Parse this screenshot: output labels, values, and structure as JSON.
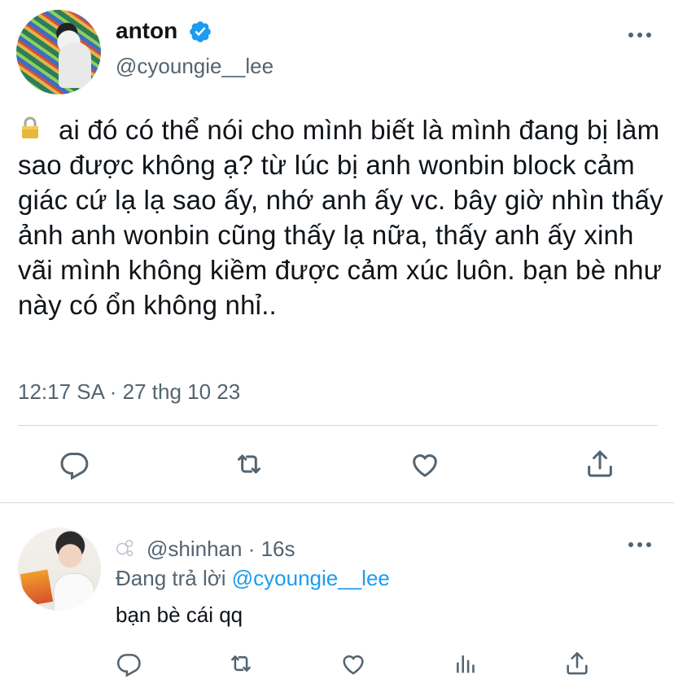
{
  "tweet": {
    "author_name": "anton",
    "author_handle": "@cyoungie__lee",
    "verified": true,
    "lock_emoji": "lock-icon",
    "text": "ai đó có thể nói cho mình biết là mình đang bị làm sao được không ạ? từ lúc bị anh wonbin block cảm giác cứ lạ lạ sao ấy, nhớ anh ấy vc. bây giờ nhìn thấy ảnh anh wonbin cũng thấy lạ nữa, thấy anh ấy xinh vãi mình không kiềm được cảm xúc luôn. bạn bè như này có ổn không nhỉ..",
    "timestamp": "12:17 SA · 27 thg 10 23"
  },
  "reply": {
    "handle": "@shinhan",
    "separator": " · ",
    "time": "16s",
    "replying_prefix": "Đang trả lời ",
    "replying_to": "@cyoungie__lee",
    "text": "bạn bè cái qq"
  },
  "colors": {
    "accent": "#1d9bf0",
    "muted": "#536471",
    "text": "#0f1419",
    "divider": "#cfd9de"
  },
  "icons": [
    "reply-icon",
    "retweet-icon",
    "like-icon",
    "share-icon",
    "analytics-icon",
    "more-icon",
    "verified-icon",
    "lock-icon",
    "bubbles-icon"
  ]
}
